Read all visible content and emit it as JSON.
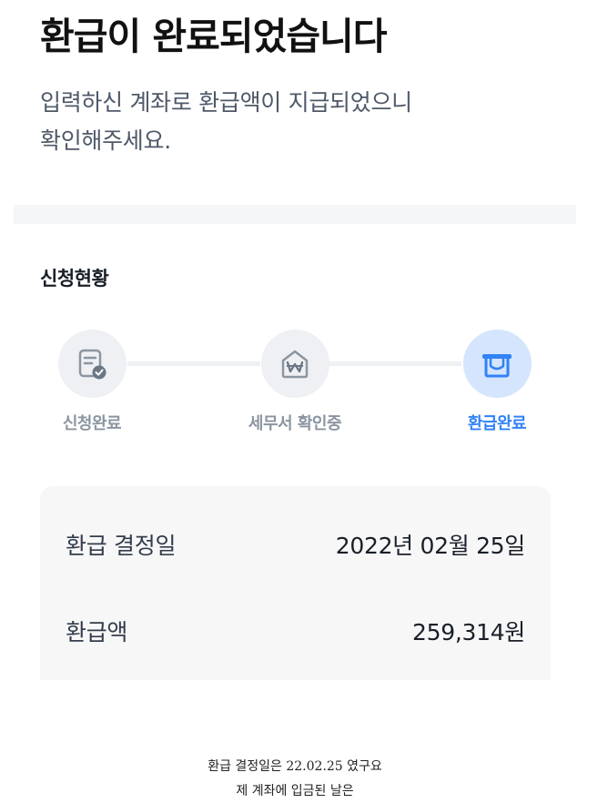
{
  "header": {
    "title": "환급이 완료되었습니다",
    "subtitle_line1": "입력하신 계좌로 환급액이 지급되었으니",
    "subtitle_line2": "확인해주세요."
  },
  "status": {
    "section_title": "신청현황",
    "steps": [
      {
        "label": "신청완료",
        "icon": "document-check-icon",
        "state": "done"
      },
      {
        "label": "세무서 확인중",
        "icon": "won-envelope-icon",
        "state": "done"
      },
      {
        "label": "환급완료",
        "icon": "cash-tray-icon",
        "state": "active"
      }
    ],
    "colors": {
      "active": "#3182f6",
      "active_bg": "#d4e5fd",
      "inactive": "#8b95a1",
      "inactive_bg": "#eef0f3"
    }
  },
  "details": {
    "rows": [
      {
        "label": "환급 결정일",
        "value": "2022년 02월 25일"
      },
      {
        "label": "환급액",
        "value": "259,314원"
      }
    ]
  },
  "caption": {
    "line1": "환급 결정일은 22.02.25 였구요",
    "line2": "제 계좌에 입금된 날은"
  }
}
